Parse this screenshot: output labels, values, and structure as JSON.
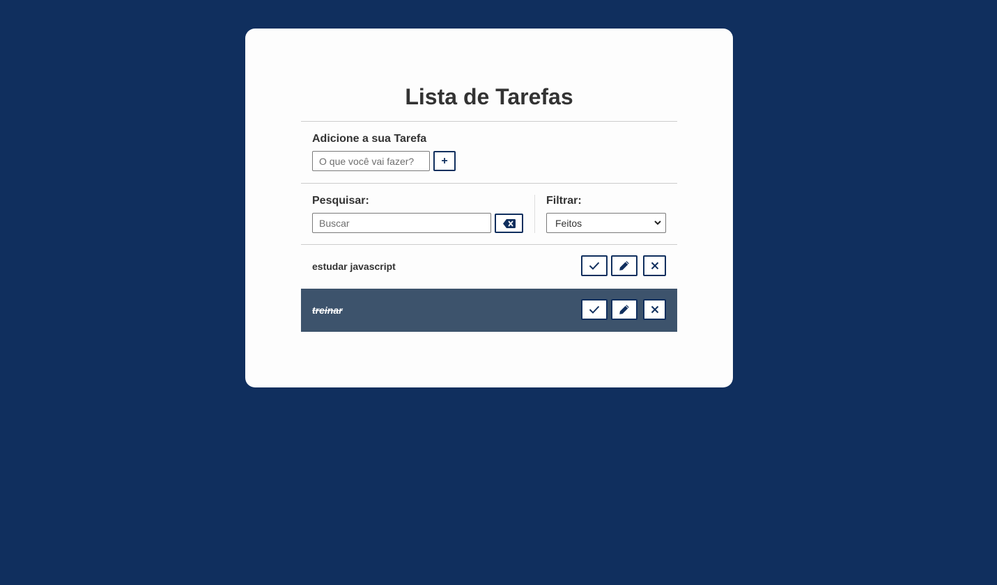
{
  "header": {
    "title": "Lista de Tarefas"
  },
  "add_form": {
    "label": "Adicione a sua Tarefa",
    "input_placeholder": "O que você vai fazer?",
    "input_value": "",
    "add_button_label": "+"
  },
  "search": {
    "label": "Pesquisar:",
    "placeholder": "Buscar",
    "value": "",
    "clear_icon": "backspace-icon"
  },
  "filter": {
    "label": "Filtrar:",
    "selected": "Feitos"
  },
  "todos": [
    {
      "title": "estudar javascript",
      "done": false
    },
    {
      "title": "treinar",
      "done": true
    }
  ],
  "actions": {
    "finish_icon": "check-icon",
    "edit_icon": "pencil-icon",
    "remove_icon": "close-icon"
  },
  "colors": {
    "page_background": "#102f5e",
    "card_background": "#fdfdfd",
    "accent": "#102f5e",
    "done_row_background": "#3d536c",
    "text": "#333333"
  }
}
